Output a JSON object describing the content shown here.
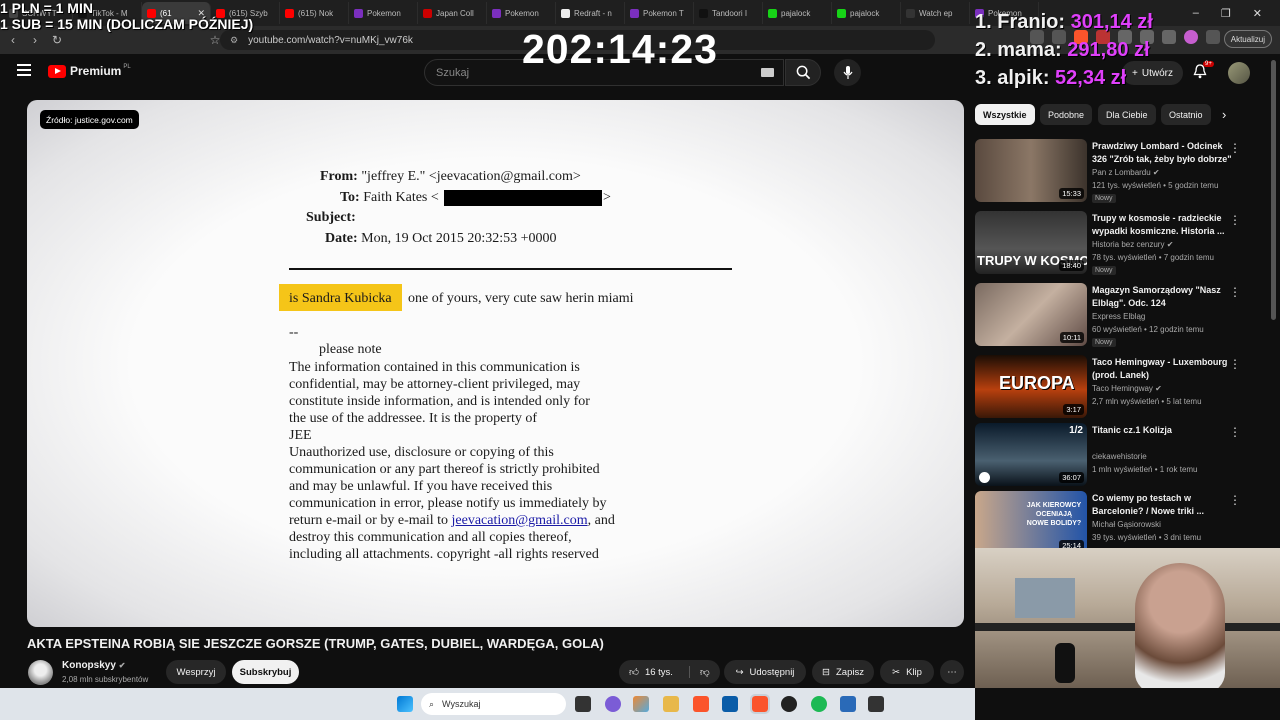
{
  "overlay": {
    "rule_line1": "1 PLN = 1 MIN",
    "rule_line2": "1 SUB = 15 MIN (DOLICZAM PÓŹNIEJ)",
    "timer": "202:14:23",
    "leaderboard": [
      {
        "rank_name": "1. Franio:",
        "amount": "301,14 zł"
      },
      {
        "rank_name": "2. mama:",
        "amount": "291,80 zł"
      },
      {
        "rank_name": "3. alpik:",
        "amount": "52,34 zł"
      }
    ],
    "amount_color": "#e040fb"
  },
  "browser": {
    "tabs": [
      "SCHWYT",
      "TikTok - M",
      "(61",
      "(615) Szyb",
      "(615) Nok",
      "Pokemon",
      "Japan Coll",
      "Pokemon",
      "Redraft - n",
      "Pokemon T",
      "Tandoori I",
      "pajalock",
      "pajalock",
      "Watch ep",
      "Pokemon"
    ],
    "active_tab_index": 2,
    "url": "youtube.com/watch?v=nuMKj_vw76k",
    "update_label": "Aktualizuj",
    "window_controls": [
      "–",
      "❐",
      "✕"
    ]
  },
  "youtube": {
    "premium_label": "Premium",
    "region": "PL",
    "search_placeholder": "Szukaj",
    "create_label": "Utwórz",
    "notif_count": "9+",
    "brand_red": "#ff0000"
  },
  "video": {
    "source_chip": "Źródło: justice.gov.com",
    "doc": {
      "from_label": "From:",
      "from_value": "\"jeffrey E.\" <jeevacation@gmail.com>",
      "to_label": "To:",
      "to_value": "Faith Kates <",
      "to_close": ">",
      "subject_label": "Subject:",
      "date_label": "Date:",
      "date_value": "Mon, 19 Oct 2015 20:32:53 +0000",
      "highlight_text": "is Sandra Kubicka",
      "body_first_rest": "one of yours,  very cute  saw herin miami",
      "dashes": "--",
      "please_note": "please note",
      "lines": [
        "The information contained in this communication is",
        "confidential, may be attorney-client privileged, may",
        "constitute inside information, and is intended only for",
        "the use of the addressee. It is the property of",
        "JEE",
        "Unauthorized use, disclosure or copying of this",
        "communication or any part thereof is strictly prohibited",
        "and may be unlawful. If you have received this",
        "communication in error, please notify us immediately by"
      ],
      "return_prefix": "return e-mail or by e-mail to",
      "return_link": "jeevacation@gmail.com",
      "return_suffix": ", and",
      "line_destroy": "destroy this communication and all copies thereof,",
      "line_last": "including all attachments. copyright -all rights reserved"
    },
    "highlight_color": "#f5c518"
  },
  "below": {
    "title": "AKTA EPSTEINA ROBIĄ SIE JESZCZE GORSZE (TRUMP, GATES, DUBIEL, WARDĘGA, GOLA)",
    "channel": "Konopskyy",
    "subs": "2,08 mln subskrybentów",
    "support": "Wesprzyj",
    "subscribe": "Subskrybuj",
    "likes": "16 tys.",
    "share": "Udostępnij",
    "save": "Zapisz",
    "clip": "Klip",
    "more": "⋯"
  },
  "sidebar": {
    "chips": [
      "Wszystkie",
      "Podobne",
      "Dla Ciebie",
      "Ostatnio"
    ],
    "videos": [
      {
        "title": "Prawdziwy Lombard - Odcinek 326 \"Zrób tak, żeby było dobrze\"",
        "channel": "Pan z Lombardu ✔",
        "meta": "121 tys. wyświetleń • 5 godzin temu",
        "badge": "Nowy",
        "duration": "15:33"
      },
      {
        "title": "Trupy w kosmosie - radzieckie wypadki kosmiczne. Historia ...",
        "channel": "Historia bez cenzury ✔",
        "meta": "78 tys. wyświetleń • 7 godzin temu",
        "badge": "Nowy",
        "duration": "18:40",
        "thumb_text": "TRUPY W KOSMOSIE"
      },
      {
        "title": "Magazyn Samorządowy \"Nasz Elbląg\". Odc. 124",
        "channel": "Express Elbląg",
        "meta": "60 wyświetleń • 12 godzin temu",
        "badge": "Nowy",
        "duration": "10:11"
      },
      {
        "title": "Taco Hemingway - Luxembourg (prod. Lanek)",
        "channel": "Taco Hemingway ✔",
        "meta": "2,7 mln wyświetleń • 5 lat temu",
        "badge": "",
        "duration": "3:17",
        "thumb_text": "EUROPA"
      },
      {
        "title": "Titanic cz.1 Kolizja",
        "channel": "ciekawehistorie",
        "meta": "1 mln wyświetleń • 1 rok temu",
        "badge": "",
        "duration": "36:07",
        "thumb_text": "1/2"
      },
      {
        "title": "Co wiemy po testach w Barcelonie? / Nowe triki ...",
        "channel": "Michał Gąsiorowski",
        "meta": "39 tys. wyświetleń • 3 dni temu",
        "badge": "",
        "duration": "25:14",
        "thumb_text": "JAK KIEROWCY OCENIAJĄ NOWE BOLIDY?"
      }
    ]
  },
  "taskbar": {
    "search_placeholder": "Wyszukaj"
  }
}
